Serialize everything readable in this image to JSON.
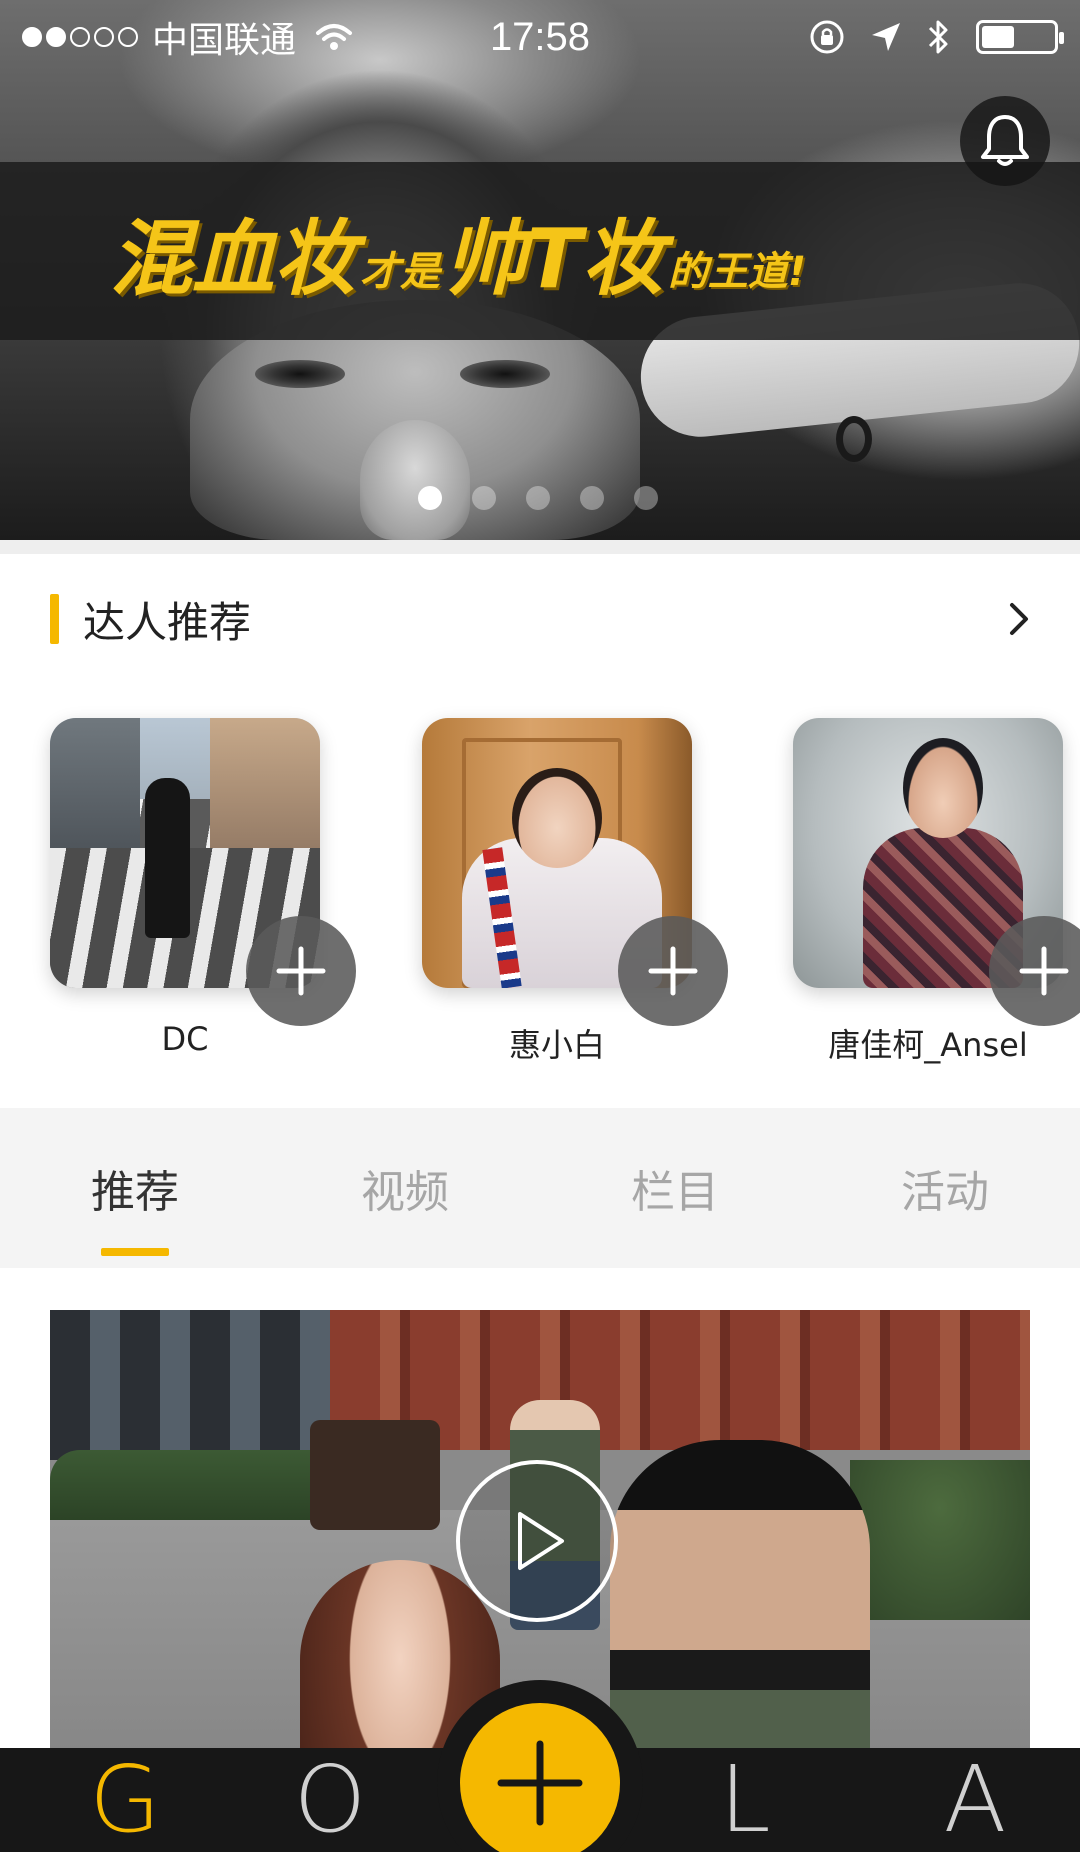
{
  "status_bar": {
    "signal_bars_filled": 2,
    "signal_bars_total": 5,
    "carrier": "中国联通",
    "time": "17:58",
    "battery_level": 0.45,
    "icons": [
      "wifi-icon",
      "orientation-lock-icon",
      "location-arrow-icon",
      "bluetooth-icon",
      "battery-icon"
    ]
  },
  "banner": {
    "headline_part1": "混血妆",
    "headline_part2": "才是",
    "headline_part3": "帅T妆",
    "headline_part4": "的王道!",
    "active_slide": 1,
    "slide_count": 5,
    "accent_color": "#f5c518",
    "bell_icon": "bell-icon"
  },
  "experts": {
    "title": "达人推荐",
    "more_icon": "chevron-right-icon",
    "accent_color": "#f5b800",
    "items": [
      {
        "name": "DC",
        "photo": "street-photo",
        "follow_icon": "plus-icon"
      },
      {
        "name": "惠小白",
        "photo": "room-portrait",
        "follow_icon": "plus-icon"
      },
      {
        "name": "唐佳柯_Ansel",
        "photo": "studio-portrait",
        "follow_icon": "plus-icon"
      }
    ]
  },
  "tabs": {
    "items": [
      "推荐",
      "视频",
      "栏目",
      "活动"
    ],
    "active_index": 0,
    "active_color": "#333333",
    "inactive_color": "#a6a6a6",
    "indicator_color": "#f5b800"
  },
  "video_card": {
    "play_icon": "play-icon"
  },
  "bottom_nav": {
    "items": [
      {
        "letter": "G",
        "active": true
      },
      {
        "letter": "O",
        "active": false
      },
      {
        "letter": "L",
        "active": false
      },
      {
        "letter": "A",
        "active": false
      }
    ],
    "center_icon": "plus-icon",
    "center_color": "#f5b800",
    "background": "#171717"
  }
}
